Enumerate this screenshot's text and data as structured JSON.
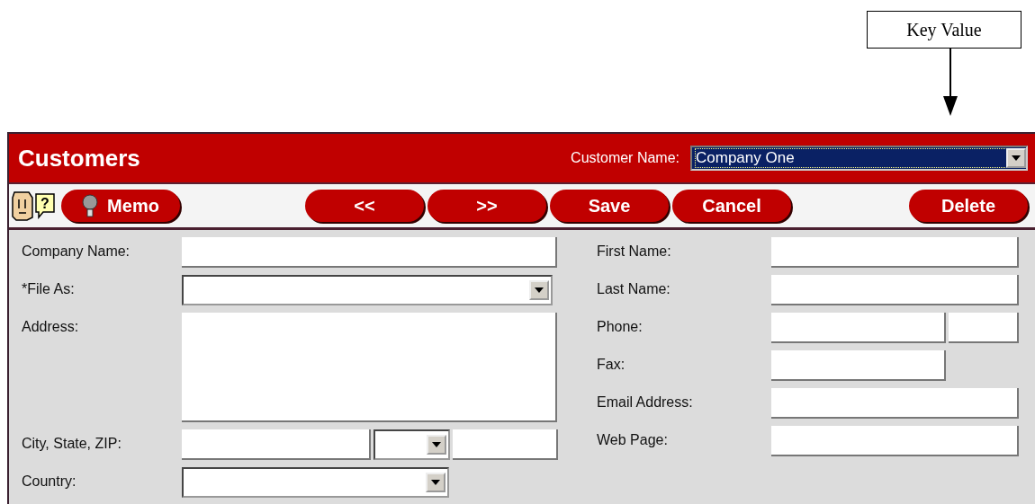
{
  "annotation": {
    "label": "Key Value"
  },
  "header": {
    "title": "Customers",
    "selector_label": "Customer Name:",
    "selector_value": "Company One"
  },
  "toolbar": {
    "help_glyph": "?",
    "left": [
      "Memo"
    ],
    "middle": [
      "<<",
      ">>",
      "Save",
      "Cancel"
    ],
    "right": [
      "Delete"
    ]
  },
  "form": {
    "left": [
      {
        "label": "Company Name:",
        "kind": "text"
      },
      {
        "label": "*File As:",
        "kind": "dropdown"
      },
      {
        "label": "Address:",
        "kind": "memo"
      },
      {
        "label": "City, State, ZIP:",
        "kind": "city"
      },
      {
        "label": "Country:",
        "kind": "country"
      }
    ],
    "right": [
      {
        "label": "First Name:",
        "kind": "text"
      },
      {
        "label": "Last Name:",
        "kind": "text"
      },
      {
        "label": "Phone:",
        "kind": "phone"
      },
      {
        "label": "Fax:",
        "kind": "short"
      },
      {
        "label": "Email Address:",
        "kind": "text"
      },
      {
        "label": "Web Page:",
        "kind": "text"
      }
    ]
  }
}
